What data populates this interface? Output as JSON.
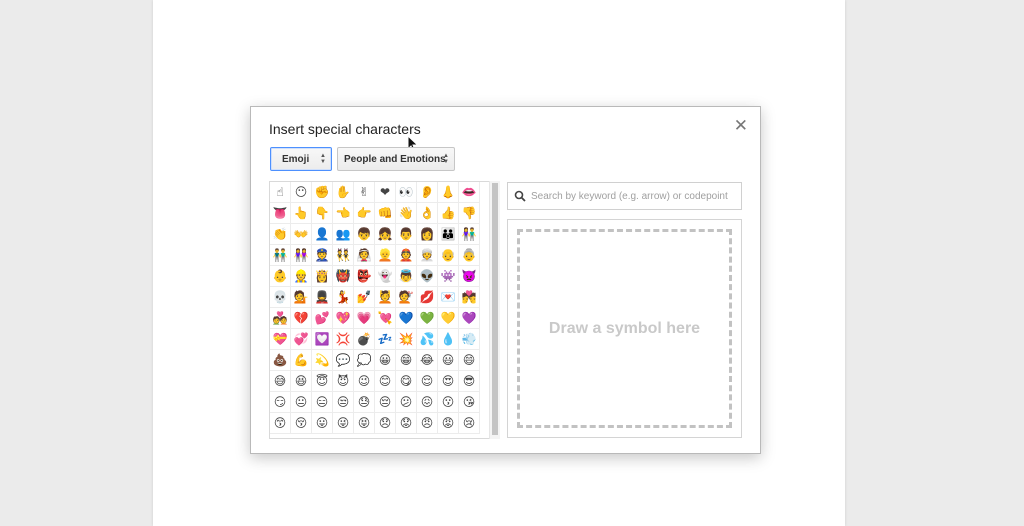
{
  "dialog": {
    "title": "Insert special characters",
    "close_symbol": "✕",
    "type_select": {
      "value": "Emoji"
    },
    "category_select": {
      "value": "People and Emotions"
    },
    "search": {
      "placeholder": "Search by keyword (e.g. arrow) or codepoint",
      "value": ""
    },
    "draw_area": {
      "label": "Draw a symbol here"
    },
    "emoji_rows": [
      [
        "☝",
        "😶",
        "✊",
        "✋",
        "✌",
        "❤",
        "👀",
        "👂",
        "👃",
        "👄"
      ],
      [
        "👅",
        "👆",
        "👇",
        "👈",
        "👉",
        "👊",
        "👋",
        "👌",
        "👍",
        "👎"
      ],
      [
        "👏",
        "👐",
        "👤",
        "👥",
        "👦",
        "👧",
        "👨",
        "👩",
        "👪",
        "👫"
      ],
      [
        "👬",
        "👭",
        "👮",
        "👯",
        "👰",
        "👱",
        "👲",
        "👳",
        "👴",
        "👵"
      ],
      [
        "👶",
        "👷",
        "👸",
        "👹",
        "👺",
        "👻",
        "👼",
        "👽",
        "👾",
        "👿"
      ],
      [
        "💀",
        "💁",
        "💂",
        "💃",
        "💅",
        "💆",
        "💇",
        "💋",
        "💌",
        "💏"
      ],
      [
        "💑",
        "💔",
        "💕",
        "💖",
        "💗",
        "💘",
        "💙",
        "💚",
        "💛",
        "💜"
      ],
      [
        "💝",
        "💞",
        "💟",
        "💢",
        "💣",
        "💤",
        "💥",
        "💦",
        "💧",
        "💨"
      ],
      [
        "💩",
        "💪",
        "💫",
        "💬",
        "💭",
        "😀",
        "😁",
        "😂",
        "😃",
        "😄"
      ],
      [
        "😅",
        "😆",
        "😇",
        "😈",
        "😉",
        "😊",
        "😋",
        "😌",
        "😍",
        "😎"
      ],
      [
        "😏",
        "😐",
        "😑",
        "😒",
        "😓",
        "😔",
        "😕",
        "😖",
        "😗",
        "😘"
      ],
      [
        "😙",
        "😚",
        "😛",
        "😜",
        "😝",
        "😞",
        "😟",
        "😠",
        "😡",
        "😢"
      ]
    ]
  },
  "colors": {
    "focus_border": "#4d90fe",
    "dialog_border": "#b9b9b9",
    "draw_dash": "#c2c2c2",
    "page_background": "#ebebeb"
  },
  "icons": {
    "close": "close-icon",
    "search": "search-icon",
    "select_arrows": "sort-arrows-icon",
    "cursor": "mouse-pointer-icon"
  }
}
